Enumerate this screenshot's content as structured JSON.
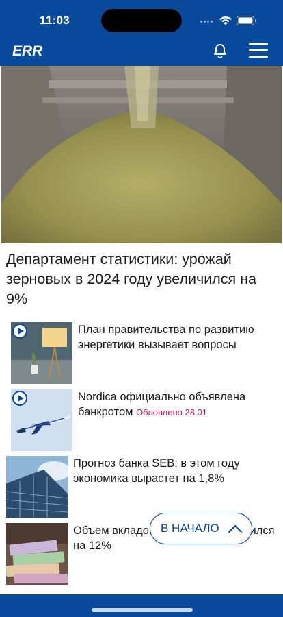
{
  "status_bar": {
    "time": "11:03"
  },
  "header": {
    "logo_text": "ERR",
    "bell_icon": "bell-icon",
    "menu_icon": "hamburger-menu-icon"
  },
  "hero": {
    "image": "grain-pile-photo",
    "headline": "Департамент статистики: урожай зерновых в 2024 году увеличился на 9%"
  },
  "news": [
    {
      "title": "План правительства по развитию энергетики вызывает вопросы",
      "has_video": true,
      "image": "lamp-photo"
    },
    {
      "title": "Nordica официально объявлена банкротом",
      "updated": "Обновлено 28.01",
      "has_video": true,
      "image": "airplane-photo"
    },
    {
      "title": "Прогноз банка SEB: в этом году экономика вырастет на 1,8%",
      "has_video": false,
      "image": "building-photo"
    },
    {
      "title": "Объем вкладов в декабре увеличился на 12%",
      "has_video": false,
      "image": "banknotes-photo"
    }
  ],
  "back_to_top": {
    "label": "В НАЧАЛО",
    "icon": "chevron-up-icon"
  },
  "colors": {
    "brand": "#0a4a9c",
    "updated": "#c2185b"
  }
}
